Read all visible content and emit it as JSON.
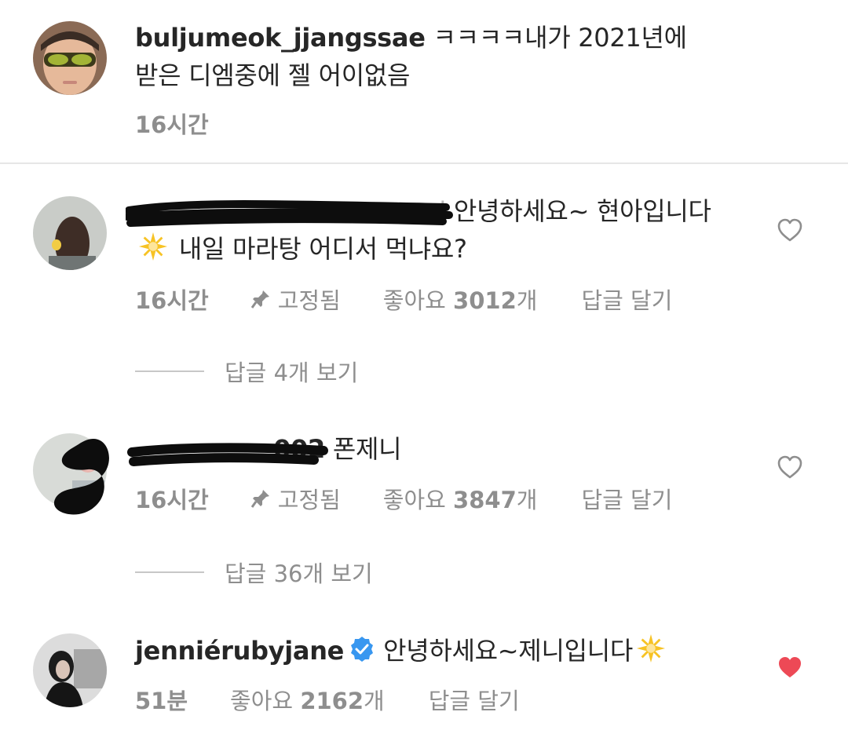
{
  "comments": [
    {
      "username": "buljumeok_jjangssae",
      "text": " ㅋㅋㅋㅋ내가 2021년에 받은 디엠중에 젤 어이없음",
      "time": "16시간"
    },
    {
      "username_partial": "i",
      "text_before": " 안녕하세요~ 현아입니다 ",
      "text_after": " 내일 마라탕 어디서 먹냐요?",
      "time": "16시간",
      "pinned_label": "고정됨",
      "likes_prefix": "좋아요 ",
      "likes_count": "3012",
      "likes_suffix": "개",
      "reply_label": "답글 달기",
      "view_replies": "답글 4개 보기",
      "liked": false
    },
    {
      "username_partial": "002",
      "text": " 폰제니",
      "time": "16시간",
      "pinned_label": "고정됨",
      "likes_prefix": "좋아요 ",
      "likes_count": "3847",
      "likes_suffix": "개",
      "reply_label": "답글 달기",
      "view_replies": "답글 36개 보기",
      "liked": false
    },
    {
      "username": "jenniérubyjane",
      "text": "안녕하세요~제니입니다",
      "time": "51분",
      "likes_prefix": "좋아요 ",
      "likes_count": "2162",
      "likes_suffix": "개",
      "reply_label": "답글 달기",
      "liked": true,
      "verified": true
    }
  ],
  "icons": {
    "heart": "heart-outline-icon",
    "heart_filled": "heart-filled-icon",
    "pin": "pin-icon",
    "verified": "verified-badge-icon",
    "sparkle": "sparkle-emoji"
  },
  "colors": {
    "text": "#262626",
    "secondary": "#8e8e8e",
    "liked_heart": "#ed4956",
    "verified": "#3897f0",
    "divider": "#e6e6e6"
  }
}
